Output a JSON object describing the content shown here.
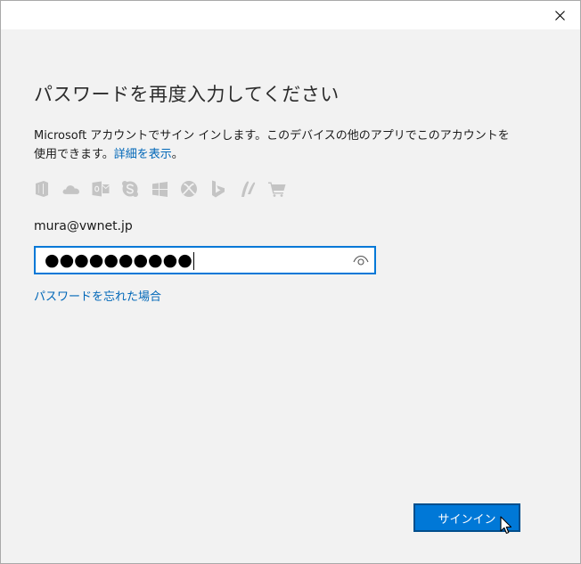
{
  "window": {
    "close_label": "×"
  },
  "heading": "パスワードを再度入力してください",
  "description": {
    "text": "Microsoft アカウントでサイン インします。このデバイスの他のアプリでこのアカウントを使用できます。",
    "link": "詳細を表示",
    "suffix": "。"
  },
  "services": [
    {
      "name": "office-icon"
    },
    {
      "name": "onedrive-icon"
    },
    {
      "name": "outlook-icon"
    },
    {
      "name": "skype-icon"
    },
    {
      "name": "windows-icon"
    },
    {
      "name": "xbox-icon"
    },
    {
      "name": "bing-icon"
    },
    {
      "name": "msn-icon"
    },
    {
      "name": "store-icon"
    }
  ],
  "account": {
    "email": "mura@vwnet.jp",
    "password_mask": "●●●●●●●●●●"
  },
  "forgot_password": "パスワードを忘れた場合",
  "signin_button": "サインイン",
  "colors": {
    "accent": "#0078d7",
    "link": "#0067b8",
    "icon_gray": "#c4c4c4"
  }
}
